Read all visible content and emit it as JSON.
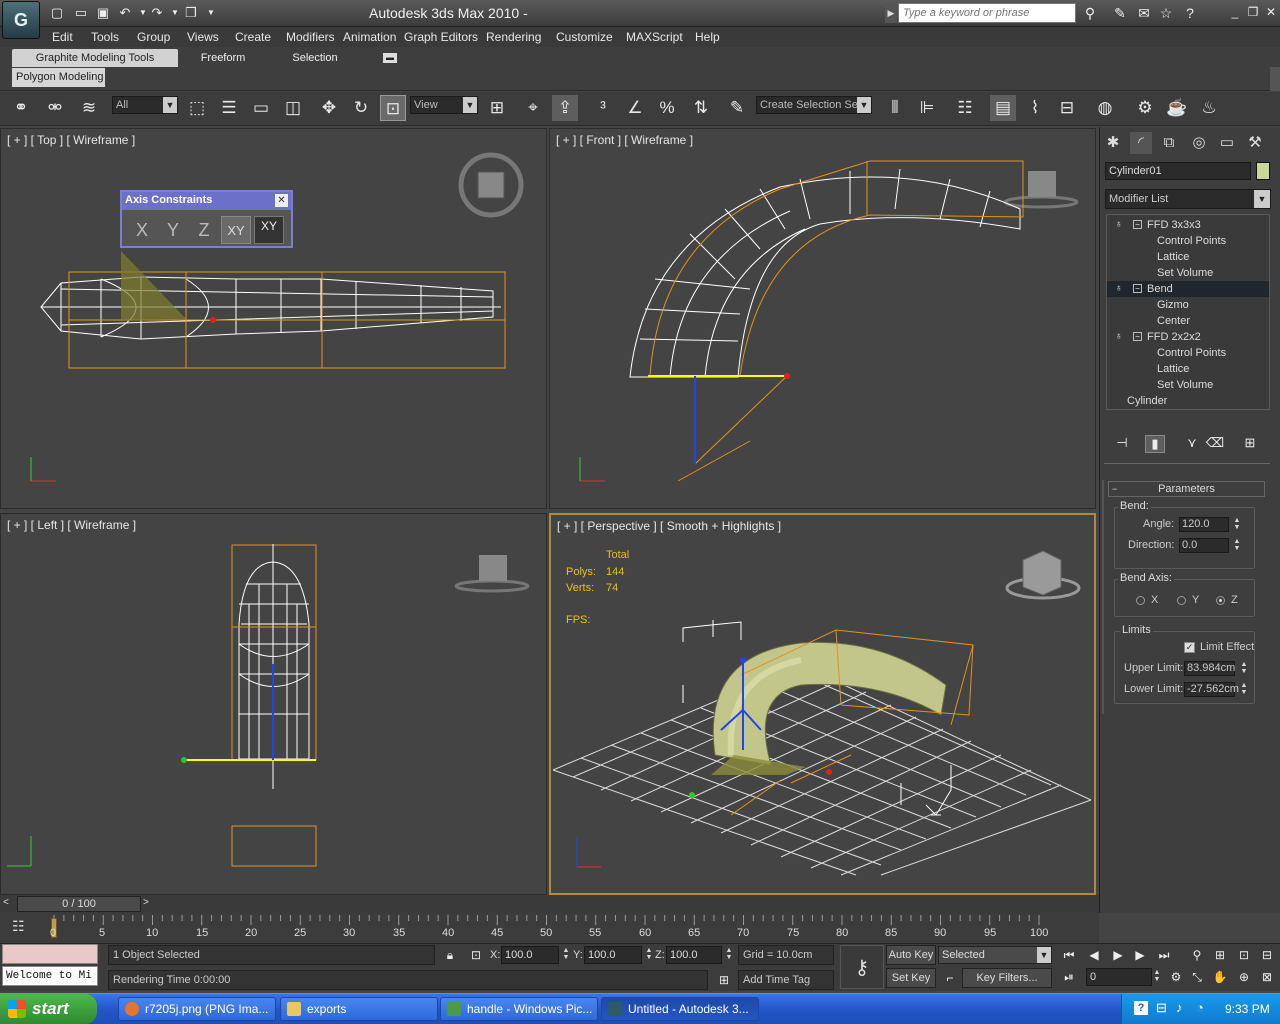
{
  "titlebar": {
    "title": "Autodesk 3ds Max  2010   -",
    "search_placeholder": "Type a keyword or phrase"
  },
  "menu": [
    "Edit",
    "Tools",
    "Group",
    "Views",
    "Create",
    "Modifiers",
    "Animation",
    "Graph Editors",
    "Rendering",
    "Customize",
    "MAXScript",
    "Help"
  ],
  "ribbon": {
    "tabs": [
      "Graphite Modeling Tools",
      "Freeform",
      "Selection"
    ],
    "subtab": "Polygon Modeling"
  },
  "toolbar": {
    "filter_value": "All",
    "refcoord_value": "View",
    "selection_set_placeholder": "Create Selection Se"
  },
  "axis_constraints": {
    "title": "Axis Constraints",
    "buttons": [
      "X",
      "Y",
      "Z",
      "XY",
      "XY"
    ]
  },
  "viewports": {
    "top": {
      "label": "[ + ] [ Top ] [ Wireframe ]",
      "cube": "TOP"
    },
    "front": {
      "label": "[ + ] [ Front ] [ Wireframe ]",
      "cube": "FRONT"
    },
    "left": {
      "label": "[ + ] [ Left ] [ Wireframe ]",
      "cube": "LEFT"
    },
    "perspective": {
      "label": "[ + ] [ Perspective ] [ Smooth + Highlights ]",
      "cube": "FRONT",
      "stats": {
        "total_label": "Total",
        "polys_label": "Polys:",
        "polys": "144",
        "verts_label": "Verts:",
        "verts": "74",
        "fps_label": "FPS:"
      }
    }
  },
  "command_panel": {
    "object_name": "Cylinder01",
    "object_color": "#c9d898",
    "modifier_list": "Modifier List",
    "stack": [
      {
        "label": "FFD 3x3x3",
        "level": 0,
        "bulb": true,
        "box": true
      },
      {
        "label": "Control Points",
        "level": 1
      },
      {
        "label": "Lattice",
        "level": 1
      },
      {
        "label": "Set Volume",
        "level": 1
      },
      {
        "label": "Bend",
        "level": 0,
        "bulb": true,
        "box": true,
        "selected": true
      },
      {
        "label": "Gizmo",
        "level": 1
      },
      {
        "label": "Center",
        "level": 1
      },
      {
        "label": "FFD 2x2x2",
        "level": 0,
        "bulb": true,
        "box": true
      },
      {
        "label": "Control Points",
        "level": 1
      },
      {
        "label": "Lattice",
        "level": 1
      },
      {
        "label": "Set Volume",
        "level": 1
      },
      {
        "label": "Cylinder",
        "level": 2
      }
    ],
    "parameters": {
      "title": "Parameters",
      "bend_label": "Bend:",
      "angle_label": "Angle:",
      "angle": "120.0",
      "direction_label": "Direction:",
      "direction": "0.0",
      "bend_axis_label": "Bend Axis:",
      "axis_options": [
        "X",
        "Y",
        "Z"
      ],
      "axis_selected": "Z",
      "limits_label": "Limits",
      "limit_effect_label": "Limit Effect",
      "limit_effect": true,
      "upper_label": "Upper Limit:",
      "upper": "83.984cm",
      "lower_label": "Lower Limit:",
      "lower": "-27.562cm"
    }
  },
  "timeline": {
    "slider": "0 / 100",
    "ticks": [
      "0",
      "5",
      "10",
      "15",
      "20",
      "25",
      "30",
      "35",
      "40",
      "45",
      "50",
      "55",
      "60",
      "65",
      "70",
      "75",
      "80",
      "85",
      "90",
      "95",
      "100"
    ]
  },
  "status": {
    "maxscript_listener": "Welcome to Mi",
    "selection": "1 Object Selected",
    "prompt": "Rendering Time  0:00:00",
    "x_label": "X:",
    "x": "100.0",
    "y_label": "Y:",
    "y": "100.0",
    "z_label": "Z:",
    "z": "100.0",
    "grid": "Grid = 10.0cm",
    "add_time_tag": "Add Time Tag",
    "auto_key": "Auto Key",
    "set_key": "Set Key",
    "selected_dropdown": "Selected",
    "key_filters": "Key Filters...",
    "frame": "0"
  },
  "taskbar": {
    "start": "start",
    "tasks": [
      "r7205j.png (PNG Ima...",
      "exports",
      "handle - Windows Pic...",
      "Untitled - Autodesk 3..."
    ],
    "clock": "9:33 PM"
  }
}
